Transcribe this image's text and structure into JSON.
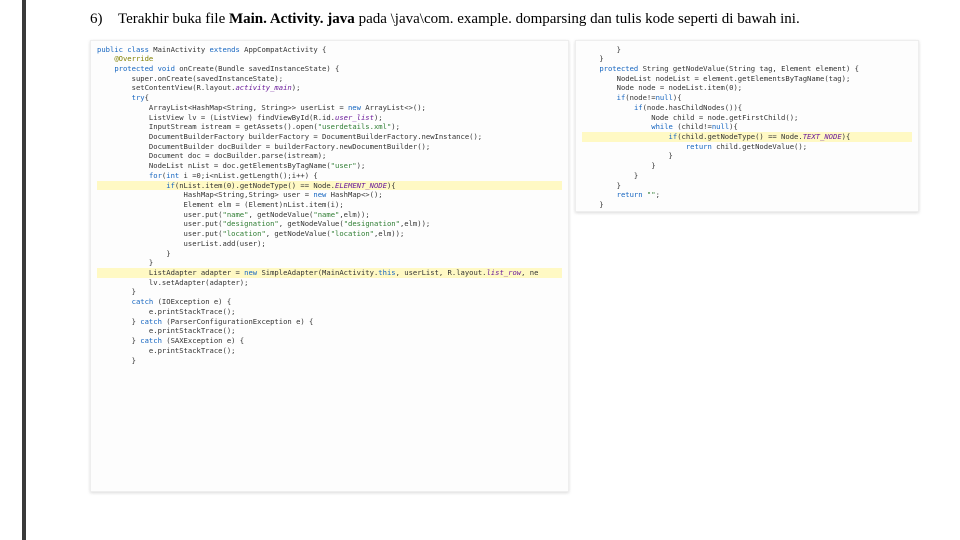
{
  "item_number": "6)",
  "instruction": {
    "part1": "Terakhir buka file ",
    "bold": "Main. Activity. java",
    "part2": " pada \\java\\com. example. domparsing dan tulis kode seperti di bawah ini."
  },
  "code_left": [
    {
      "t": "public class",
      "c": "kw",
      "rest": " MainActivity ",
      "t2": "extends",
      "c2": "kw",
      "rest2": " AppCompatActivity {"
    },
    {
      "ind": 1,
      "t": "@Override",
      "c": "ann"
    },
    {
      "ind": 1,
      "t": "protected void",
      "c": "kw",
      "rest": " onCreate(Bundle savedInstanceState) {"
    },
    {
      "ind": 2,
      "plain": "super.onCreate(savedInstanceState);"
    },
    {
      "ind": 2,
      "plain": "setContentView(R.layout.",
      "pur": "activity_main",
      "tail": ");"
    },
    {
      "ind": 2,
      "t": "try",
      "c": "kw",
      "rest": "{"
    },
    {
      "ind": 3,
      "plain": "ArrayList<HashMap<String, String>> userList = ",
      "t": "new",
      "c": "kw",
      "rest": " ArrayList<>();"
    },
    {
      "ind": 3,
      "plain": "ListView lv = (ListView) findViewById(R.id.",
      "pur": "user_list",
      "tail": ");"
    },
    {
      "ind": 3,
      "plain": "InputStream istream = getAssets().open(",
      "str": "\"userdetails.xml\"",
      "tail": ");"
    },
    {
      "ind": 3,
      "plain": "DocumentBuilderFactory builderFactory = DocumentBuilderFactory.newInstance();"
    },
    {
      "ind": 3,
      "plain": "DocumentBuilder docBuilder = builderFactory.newDocumentBuilder();"
    },
    {
      "ind": 3,
      "plain": "Document doc = docBuilder.parse(istream);"
    },
    {
      "ind": 3,
      "plain": "NodeList nList = doc.getElementsByTagName(",
      "str": "\"user\"",
      "tail": ");"
    },
    {
      "ind": 3,
      "t": "for",
      "c": "kw",
      "rest": "(",
      "t2": "int",
      "c2": "kw",
      "rest2": " i =0;i<nList.getLength();i++) {"
    },
    {
      "ind": 4,
      "hl": true,
      "t": "if",
      "c": "kw",
      "rest": "(nList.item(0).getNodeType() == Node.",
      "pur": "ELEMENT_NODE",
      "tail": "){"
    },
    {
      "ind": 5,
      "plain": "HashMap<String,String> user = ",
      "t": "new",
      "c": "kw",
      "rest": " HashMap<>();"
    },
    {
      "ind": 5,
      "plain": "Element elm = (Element)nList.item(i);"
    },
    {
      "ind": 5,
      "plain": "user.put(",
      "str": "\"name\"",
      "mid": ", getNodeValue(",
      "str2": "\"name\"",
      "tail": ",elm));"
    },
    {
      "ind": 5,
      "plain": "user.put(",
      "str": "\"designation\"",
      "mid": ", getNodeValue(",
      "str2": "\"designation\"",
      "tail": ",elm));"
    },
    {
      "ind": 5,
      "plain": "user.put(",
      "str": "\"location\"",
      "mid": ", getNodeValue(",
      "str2": "\"location\"",
      "tail": ",elm));"
    },
    {
      "ind": 5,
      "plain": "userList.add(user);"
    },
    {
      "ind": 4,
      "plain": "}"
    },
    {
      "ind": 3,
      "plain": "}"
    },
    {
      "ind": 3,
      "hl": true,
      "plain": "ListAdapter adapter = ",
      "t": "new",
      "c": "kw",
      "rest": " SimpleAdapter(MainActivity.",
      "t2": "this",
      "c2": "kw",
      "rest2": ", userList, R.layout.",
      "pur": "list_row",
      "tail": ", ne"
    },
    {
      "ind": 3,
      "plain": "lv.setAdapter(adapter);"
    },
    {
      "ind": 2,
      "plain": "}"
    },
    {
      "ind": 2,
      "t": "catch",
      "c": "kw",
      "rest": " (IOException e) {"
    },
    {
      "ind": 3,
      "plain": "e.printStackTrace();"
    },
    {
      "ind": 2,
      "plain": "} ",
      "t": "catch",
      "c": "kw",
      "rest": " (ParserConfigurationException e) {"
    },
    {
      "ind": 3,
      "plain": "e.printStackTrace();"
    },
    {
      "ind": 2,
      "plain": "} ",
      "t": "catch",
      "c": "kw",
      "rest": " (SAXException e) {"
    },
    {
      "ind": 3,
      "plain": "e.printStackTrace();"
    },
    {
      "ind": 2,
      "plain": "}"
    }
  ],
  "code_right": [
    {
      "ind": 2,
      "plain": "}"
    },
    {
      "ind": 1,
      "plain": "}"
    },
    {
      "ind": 1,
      "t": "protected",
      "c": "kw",
      "rest": " String getNodeValue(String tag, Element element) {"
    },
    {
      "ind": 2,
      "plain": "NodeList nodeList = element.getElementsByTagName(tag);"
    },
    {
      "ind": 2,
      "plain": "Node node = nodeList.item(0);"
    },
    {
      "ind": 2,
      "t": "if",
      "c": "kw",
      "rest": "(node!=",
      "t2": "null",
      "c2": "kw",
      "rest2": "){"
    },
    {
      "ind": 3,
      "t": "if",
      "c": "kw",
      "rest": "(node.hasChildNodes()){"
    },
    {
      "ind": 4,
      "plain": "Node child = node.getFirstChild();"
    },
    {
      "ind": 4,
      "t": "while",
      "c": "kw",
      "rest": " (child!=",
      "t2": "null",
      "c2": "kw",
      "rest2": "){"
    },
    {
      "ind": 5,
      "hl": true,
      "t": "if",
      "c": "kw",
      "rest": "(child.getNodeType() == Node.",
      "pur": "TEXT_NODE",
      "tail": "){"
    },
    {
      "ind": 6,
      "t": "return",
      "c": "kw",
      "rest": " child.getNodeValue();"
    },
    {
      "ind": 5,
      "plain": "}"
    },
    {
      "ind": 4,
      "plain": "}"
    },
    {
      "ind": 3,
      "plain": "}"
    },
    {
      "ind": 2,
      "plain": "}"
    },
    {
      "ind": 2,
      "t": "return",
      "c": "kw",
      "rest": " ",
      "str": "\"\"",
      "tail": ";"
    },
    {
      "ind": 1,
      "plain": "}"
    },
    {
      "ind": 0,
      "plain": "}"
    }
  ]
}
